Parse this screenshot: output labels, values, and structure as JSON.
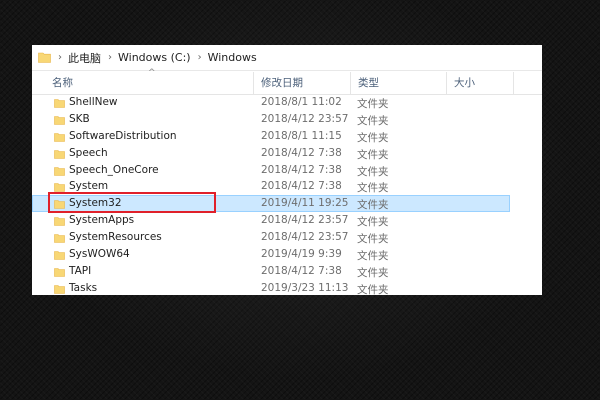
{
  "breadcrumb": [
    "此电脑",
    "Windows (C:)",
    "Windows"
  ],
  "breadcrumb_separator": "›",
  "columns": {
    "name": "名称",
    "date": "修改日期",
    "type": "类型",
    "size": "大小"
  },
  "sort_indicator": "^",
  "rows": [
    {
      "name": "ShellNew",
      "date": "2018/8/1 11:02",
      "type": "文件夹"
    },
    {
      "name": "SKB",
      "date": "2018/4/12 23:57",
      "type": "文件夹"
    },
    {
      "name": "SoftwareDistribution",
      "date": "2018/8/1 11:15",
      "type": "文件夹"
    },
    {
      "name": "Speech",
      "date": "2018/4/12 7:38",
      "type": "文件夹"
    },
    {
      "name": "Speech_OneCore",
      "date": "2018/4/12 7:38",
      "type": "文件夹"
    },
    {
      "name": "System",
      "date": "2018/4/12 7:38",
      "type": "文件夹"
    },
    {
      "name": "System32",
      "date": "2019/4/11 19:25",
      "type": "文件夹",
      "selected": true
    },
    {
      "name": "SystemApps",
      "date": "2018/4/12 23:57",
      "type": "文件夹"
    },
    {
      "name": "SystemResources",
      "date": "2018/4/12 23:57",
      "type": "文件夹"
    },
    {
      "name": "SysWOW64",
      "date": "2019/4/19 9:39",
      "type": "文件夹"
    },
    {
      "name": "TAPI",
      "date": "2018/4/12 7:38",
      "type": "文件夹"
    },
    {
      "name": "Tasks",
      "date": "2019/3/23 11:13",
      "type": "文件夹"
    }
  ],
  "icons": {
    "folder": "folder-icon"
  },
  "colors": {
    "folder": "#f8d775",
    "folder_dark": "#e8b64a",
    "selection_bg": "#cce8ff",
    "selection_border": "#99d1ff",
    "highlight": "#e0202a"
  }
}
